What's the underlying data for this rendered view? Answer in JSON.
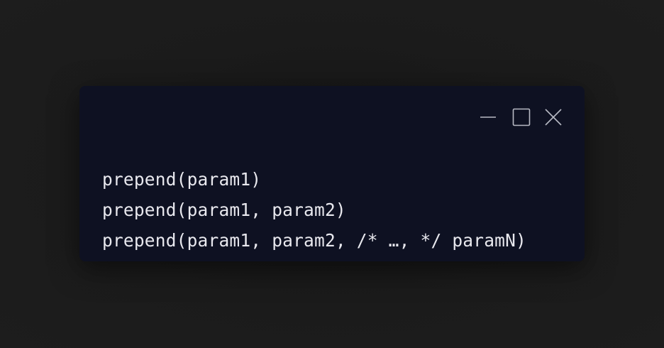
{
  "window": {
    "controls": [
      "minimize-icon",
      "maximize-icon",
      "close-icon"
    ]
  },
  "code": {
    "lines": [
      "prepend(param1)",
      "prepend(param1, param2)",
      "prepend(param1, param2, /* …, */ paramN)"
    ]
  },
  "colors": {
    "page_background": "#1c1c1c",
    "window_background": "#0e1122",
    "code_text": "#e8e8ee",
    "control_stroke": "#b8bac4"
  }
}
